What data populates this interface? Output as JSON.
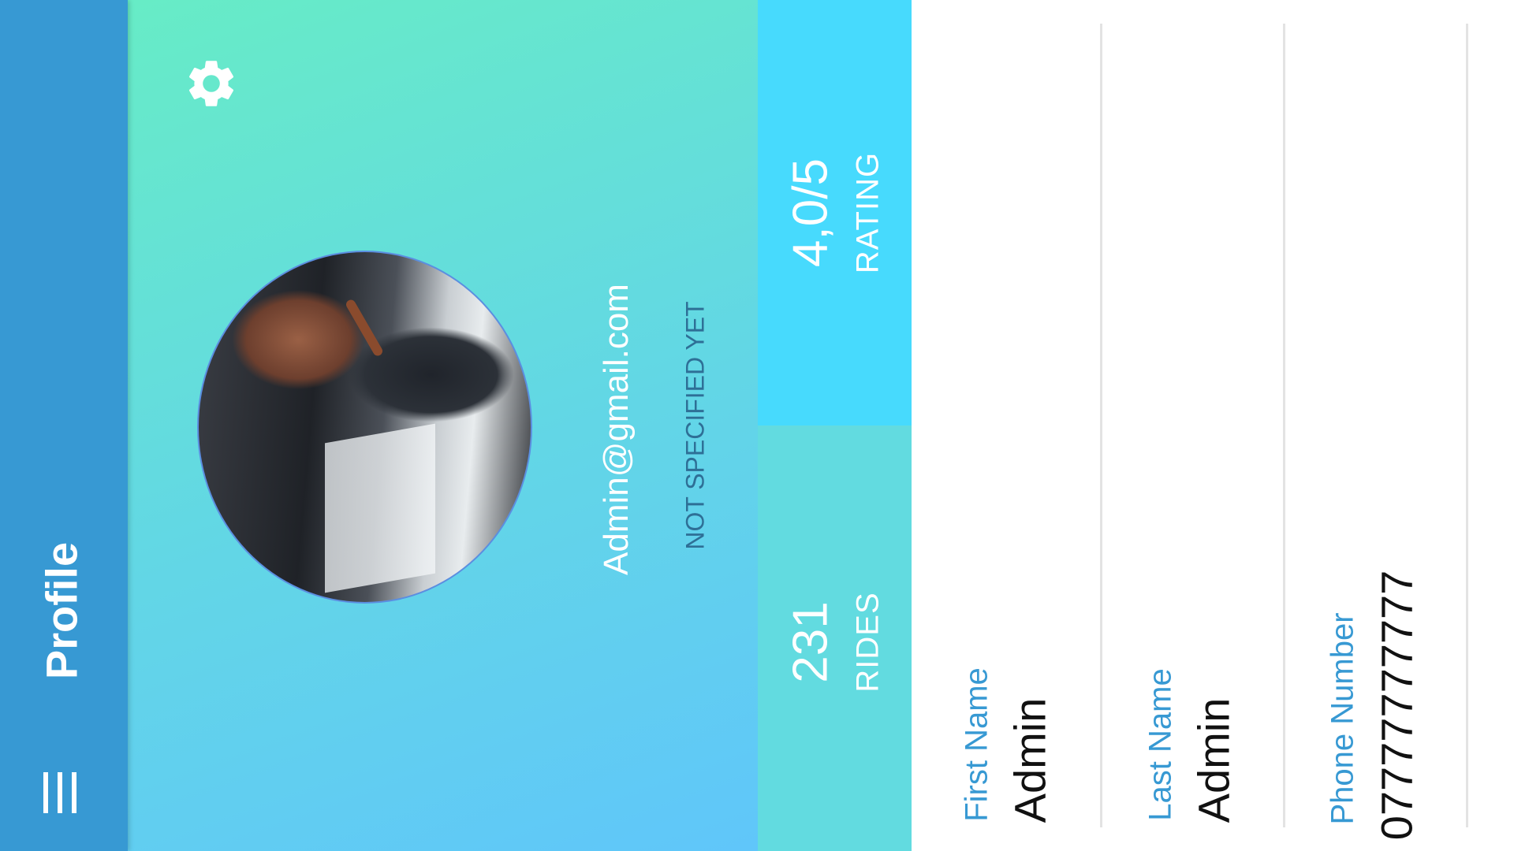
{
  "appbar": {
    "title": "Profile",
    "menu_icon": "menu-icon",
    "background": "#3799d3"
  },
  "header": {
    "settings_icon": "gear-icon",
    "email": "Admin@gmail.com",
    "status": "NOT SPECIFIED YET",
    "gradient": [
      "#67ecc6",
      "#60c6fa"
    ]
  },
  "stats": {
    "rating": {
      "value": "4,0/5",
      "label": "RATING",
      "color": "#47dafd"
    },
    "rides": {
      "value": "231",
      "label": "RIDES",
      "color": "#62dbe0"
    }
  },
  "form": {
    "fields": [
      {
        "label": "First Name",
        "value": "Admin"
      },
      {
        "label": "Last Name",
        "value": "Admin"
      },
      {
        "label": "Phone Number",
        "value": "07777777777"
      }
    ],
    "label_color": "#3799d3"
  }
}
